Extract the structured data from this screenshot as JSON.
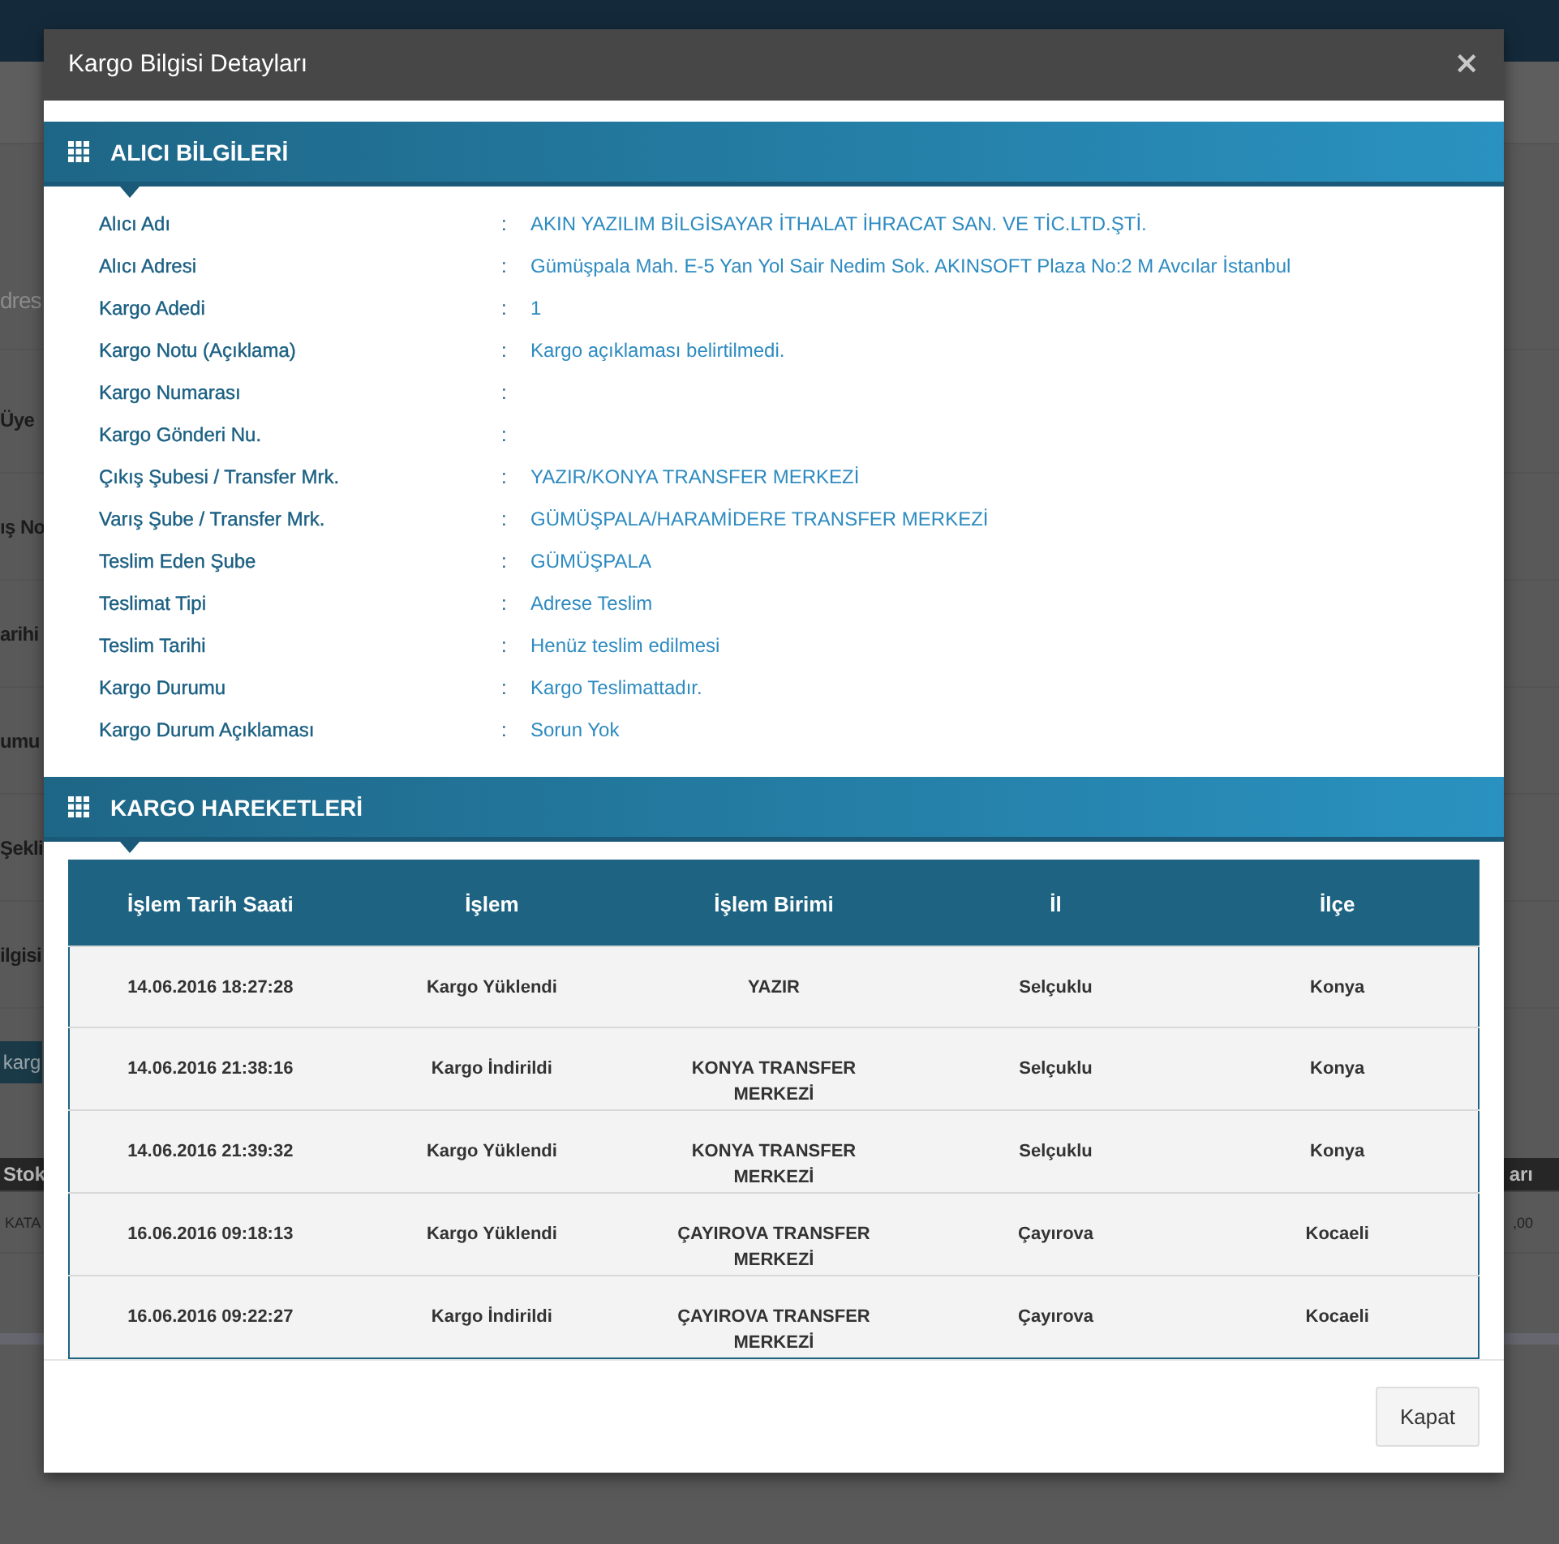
{
  "background": {
    "heading_fragment": "dres",
    "label_fragments": [
      "Üye",
      "ış No",
      "arihi",
      "umu",
      "Şekli",
      "ilgisi"
    ],
    "button_fragment": "karg",
    "table": {
      "header_left": "Stok",
      "header_right": "arı",
      "cell_left": "KATA",
      "cell_right": ",00"
    }
  },
  "dialog": {
    "title": "Kargo Bilgisi Detayları",
    "close_icon": "×",
    "recipient": {
      "title": "ALICI BİLGİLERİ",
      "separator": ":",
      "rows": [
        {
          "label": "Alıcı Adı",
          "value": "AKIN YAZILIM BİLGİSAYAR İTHALAT İHRACAT SAN. VE TİC.LTD.ŞTİ."
        },
        {
          "label": "Alıcı Adresi",
          "value": "Gümüşpala Mah. E-5 Yan Yol Sair Nedim Sok. AKINSOFT Plaza No:2 M Avcılar İstanbul"
        },
        {
          "label": "Kargo Adedi",
          "value": "1"
        },
        {
          "label": "Kargo Notu (Açıklama)",
          "value": "Kargo açıklaması belirtilmedi."
        },
        {
          "label": "Kargo Numarası"
        },
        {
          "label": "Kargo Gönderi Nu."
        },
        {
          "label": "Çıkış Şubesi / Transfer Mrk.",
          "value": "YAZIR/KONYA TRANSFER MERKEZİ"
        },
        {
          "label": "Varış Şube / Transfer Mrk.",
          "value": "GÜMÜŞPALA/HARAMİDERE TRANSFER MERKEZİ"
        },
        {
          "label": "Teslim Eden Şube",
          "value": "GÜMÜŞPALA"
        },
        {
          "label": "Teslimat Tipi",
          "value": "Adrese Teslim"
        },
        {
          "label": "Teslim Tarihi",
          "value": "Henüz teslim edilmesi"
        },
        {
          "label": "Kargo Durumu",
          "value": "Kargo Teslimattadır."
        },
        {
          "label": "Kargo Durum Açıklaması",
          "value": "Sorun Yok"
        }
      ]
    },
    "movements": {
      "title": "KARGO HAREKETLERİ",
      "columns": [
        "İşlem Tarih Saati",
        "İşlem",
        "İşlem Birimi",
        "İl",
        "İlçe"
      ],
      "rows": [
        [
          "14.06.2016 18:27:28",
          "Kargo Yüklendi",
          "YAZIR",
          "Selçuklu",
          "Konya"
        ],
        [
          "14.06.2016 21:38:16",
          "Kargo İndirildi",
          "KONYA TRANSFER MERKEZİ",
          "Selçuklu",
          "Konya"
        ],
        [
          "14.06.2016 21:39:32",
          "Kargo Yüklendi",
          "KONYA TRANSFER MERKEZİ",
          "Selçuklu",
          "Konya"
        ],
        [
          "16.06.2016 09:18:13",
          "Kargo Yüklendi",
          "ÇAYIROVA TRANSFER MERKEZİ",
          "Çayırova",
          "Kocaeli"
        ],
        [
          "16.06.2016 09:22:27",
          "Kargo İndirildi",
          "ÇAYIROVA TRANSFER MERKEZİ",
          "Çayırova",
          "Kocaeli"
        ]
      ]
    },
    "close_button": "Kapat"
  }
}
